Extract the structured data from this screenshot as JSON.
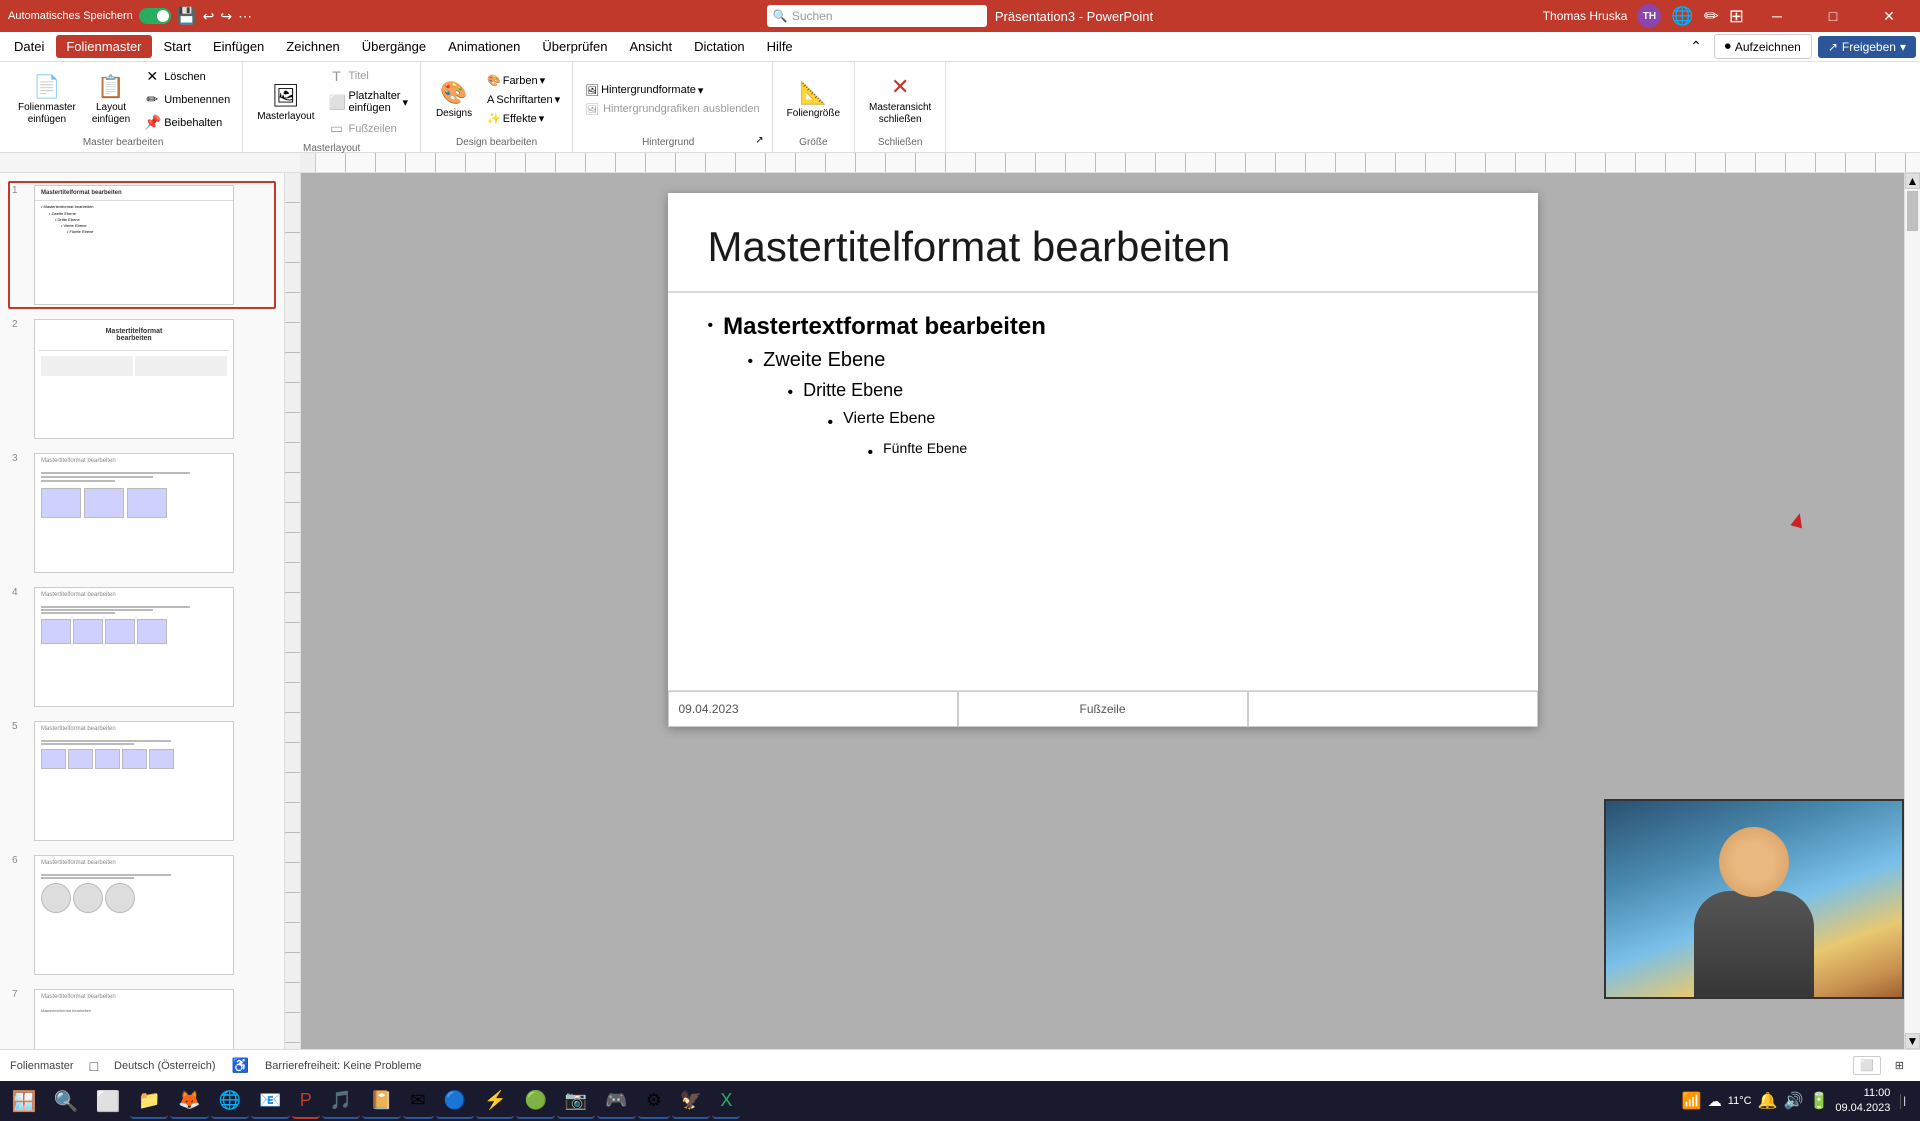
{
  "titlebar": {
    "autosave_label": "Automatisches Speichern",
    "app_name": "Präsentation3 - PowerPoint",
    "search_placeholder": "Suchen",
    "user_name": "Thomas Hruska",
    "user_initials": "TH"
  },
  "menu": {
    "items": [
      "Datei",
      "Folienmaster",
      "Start",
      "Einfügen",
      "Zeichnen",
      "Übergänge",
      "Animationen",
      "Überprüfen",
      "Ansicht",
      "Dictation",
      "Hilfe"
    ],
    "active": "Folienmaster",
    "btn_record": "Aufzeichnen",
    "btn_share": "Freigeben"
  },
  "ribbon": {
    "groups": [
      {
        "label": "Master bearbeiten",
        "buttons": [
          {
            "label": "Folienmaster\neinfügen",
            "icon": "📄",
            "large": true
          },
          {
            "label": "Layout\neinfügen",
            "icon": "📋",
            "large": true
          }
        ],
        "small_buttons": [
          {
            "label": "Löschen",
            "icon": "✕"
          },
          {
            "label": "Umbenennen",
            "icon": "✏"
          },
          {
            "label": "Beibehalten",
            "icon": "📌"
          }
        ]
      },
      {
        "label": "Masterlayout",
        "buttons": [
          {
            "label": "Masterlayout",
            "icon": "🖼",
            "large": true
          }
        ],
        "small_buttons": [
          {
            "label": "Titel",
            "icon": "T",
            "disabled": true
          },
          {
            "label": "Platzhalter\neinfügen",
            "icon": "⬜"
          },
          {
            "label": "Fußzeilen",
            "icon": "▭",
            "disabled": true
          }
        ]
      },
      {
        "label": "Design bearbeiten",
        "buttons": [
          {
            "label": "Designs",
            "icon": "🎨",
            "large": true
          }
        ],
        "small_buttons": [
          {
            "label": "Farben",
            "icon": "🎨"
          },
          {
            "label": "Schriftarten",
            "icon": "A"
          },
          {
            "label": "Effekte",
            "icon": "✨"
          }
        ]
      },
      {
        "label": "Hintergrund",
        "buttons": [],
        "small_buttons": [
          {
            "label": "Hintergrundformate",
            "icon": "🖼"
          },
          {
            "label": "Hintergrundgrafiken ausblenden",
            "icon": "🖼",
            "disabled": true
          }
        ]
      },
      {
        "label": "Größe",
        "buttons": [
          {
            "label": "Foliengröße",
            "icon": "📐",
            "large": true
          }
        ]
      },
      {
        "label": "Schließen",
        "buttons": [
          {
            "label": "Masteransicht\nschließen",
            "icon": "✕",
            "large": true
          }
        ]
      }
    ]
  },
  "slide": {
    "title": "Mastertitelformat bearbeiten",
    "bullets": [
      {
        "level": 1,
        "text": "Mastertextformat bearbeiten"
      },
      {
        "level": 2,
        "text": "Zweite Ebene"
      },
      {
        "level": 3,
        "text": "Dritte Ebene"
      },
      {
        "level": 4,
        "text": "Vierte Ebene"
      },
      {
        "level": 5,
        "text": "Fünfte Ebene"
      }
    ],
    "footer_date": "09.04.2023",
    "footer_label": "Fußzeile",
    "footer_page": ""
  },
  "thumbnails": [
    {
      "num": 1,
      "title": "Mastertitelformat bearbeiten",
      "active": true
    },
    {
      "num": 2,
      "title": "Mastertitelformat\nbearbeiten"
    },
    {
      "num": 3,
      "title": "Mastertitelformat bearbeiten"
    },
    {
      "num": 4,
      "title": "Mastertitelformat bearbeiten"
    },
    {
      "num": 5,
      "title": "Mastertitelformat bearbeiten"
    },
    {
      "num": 6,
      "title": "Mastertitelformat bearbeiten"
    },
    {
      "num": 7,
      "title": "Mastertitelformat bearbeiten"
    }
  ],
  "statusbar": {
    "view_label": "Folienmaster",
    "language": "Deutsch (Österreich)",
    "accessibility": "Barrierefreiheit: Keine Probleme"
  },
  "taskbar": {
    "apps": [
      "🪟",
      "📁",
      "🦊",
      "🌐",
      "📧",
      "📊",
      "🎵",
      "📔",
      "✉",
      "🔵",
      "⚡",
      "🟢",
      "📷",
      "🎮",
      "⚙",
      "🦅"
    ],
    "time": "11:xx",
    "temp": "11°C"
  }
}
